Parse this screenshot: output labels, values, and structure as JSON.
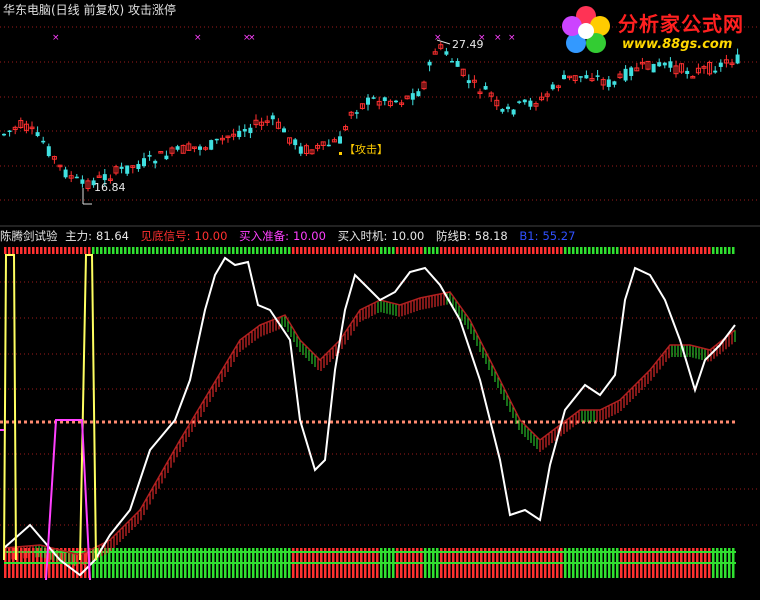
{
  "upper": {
    "title": "华东电脑(日线 前复权) 攻击涨停",
    "high_label": "27.49",
    "low_label": "16.84",
    "attack_label": "【攻击】",
    "markers": "×"
  },
  "logo": {
    "name": "分析家公式网",
    "url": "www.88gs.com"
  },
  "indicator": {
    "name": "陈腾剑试验",
    "items": [
      {
        "label": "主力:",
        "value": "81.64",
        "color": "#e6e6e6"
      },
      {
        "label": "见底信号:",
        "value": "10.00",
        "color": "#ff3030"
      },
      {
        "label": "买入准备:",
        "value": "10.00",
        "color": "#ff40ff"
      },
      {
        "label": "买入时机:",
        "value": "10.00",
        "color": "#e6e6e6"
      },
      {
        "label": "防线B:",
        "value": "58.18",
        "color": "#e6e6e6"
      },
      {
        "label": "B1:",
        "value": "55.27",
        "color": "#3050ff"
      }
    ]
  },
  "colors": {
    "up": "#ff3030",
    "down": "#40e0e0",
    "grid": "#9b1c1c",
    "green": "#30e030",
    "white": "#ffffff",
    "yellow": "#ffff60",
    "magenta": "#ff40ff",
    "salmon": "#ff8a70"
  }
}
